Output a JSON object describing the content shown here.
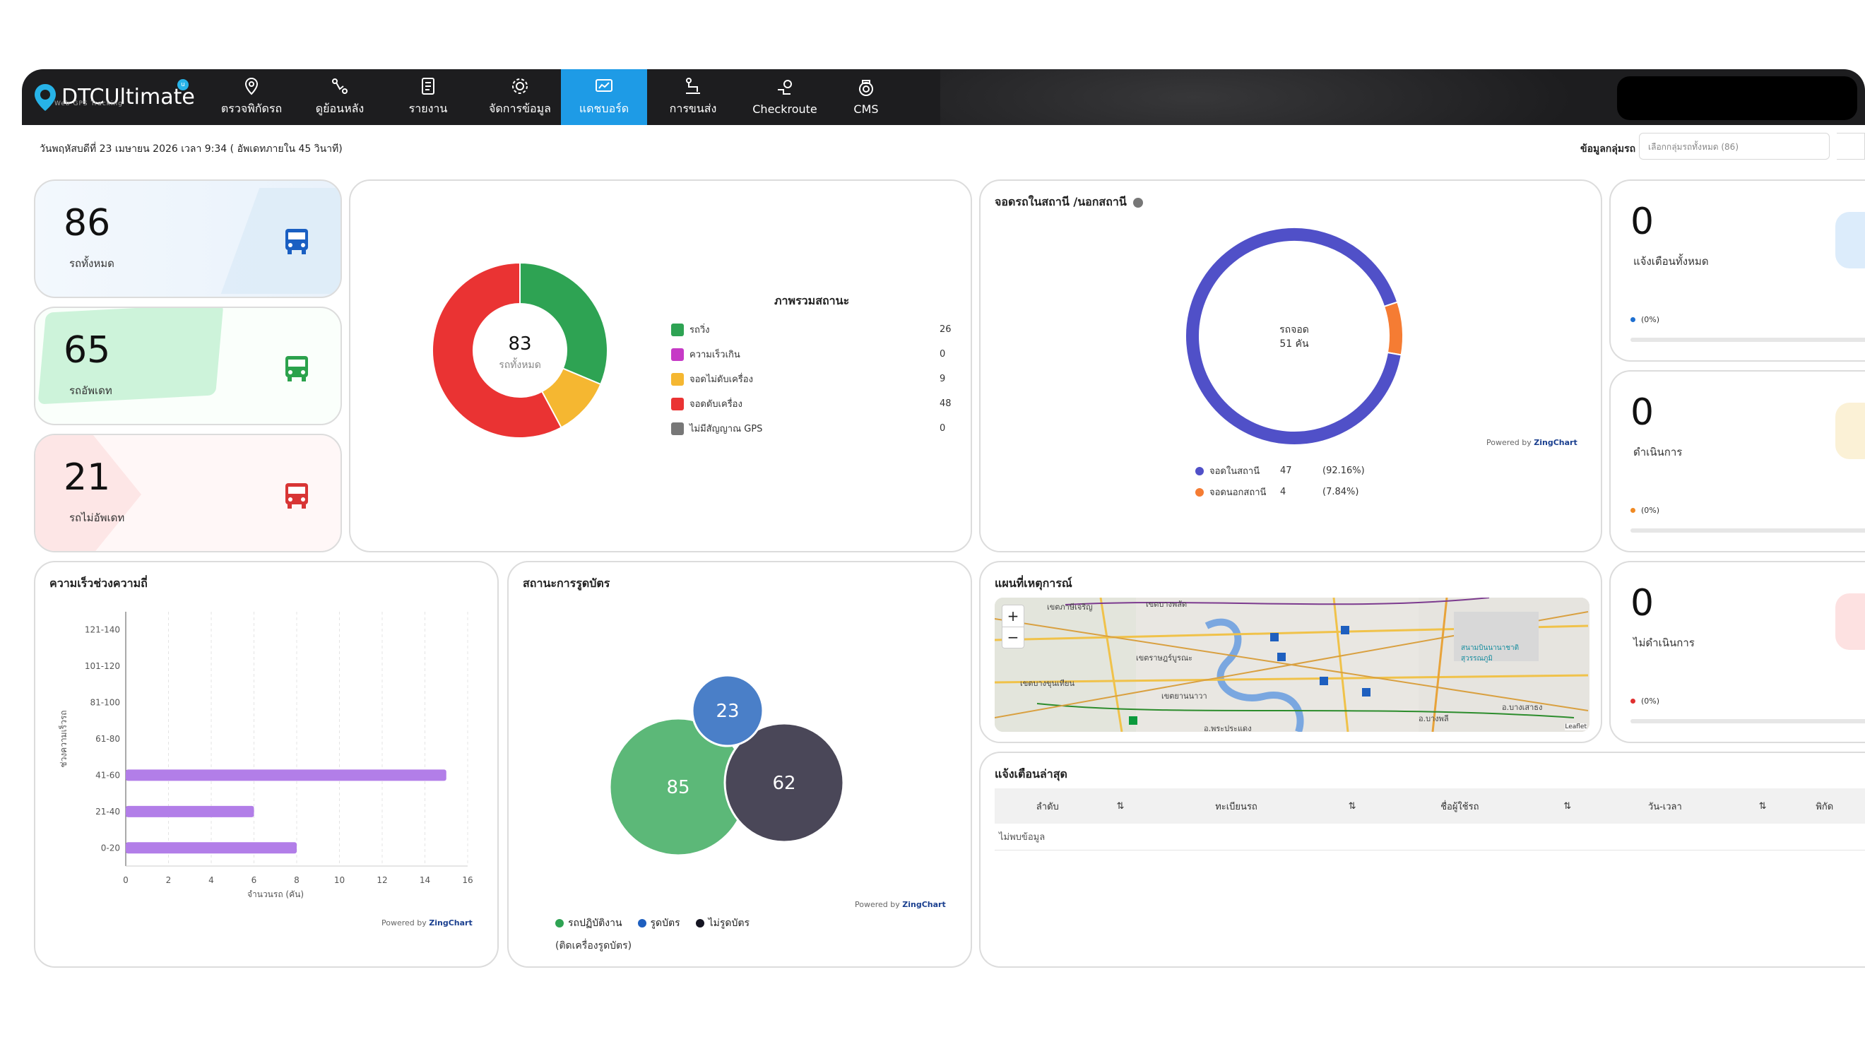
{
  "nav": {
    "brand": "DTCUltimate",
    "brand_sub": "Web GPS Tracking",
    "items": [
      {
        "label": "ตรวจพิกัดรถ",
        "icon": "map-pin-icon"
      },
      {
        "label": "ดูย้อนหลัง",
        "icon": "route-icon"
      },
      {
        "label": "รายงาน",
        "icon": "report-icon"
      },
      {
        "label": "จัดการข้อมูล",
        "icon": "manage-icon"
      },
      {
        "label": "แดชบอร์ด",
        "icon": "dashboard-icon",
        "active": true
      },
      {
        "label": "การขนส่ง",
        "icon": "transport-icon"
      },
      {
        "label": "Checkroute",
        "icon": "checkroute-icon"
      },
      {
        "label": "CMS",
        "icon": "cms-icon"
      }
    ]
  },
  "header": {
    "datetime": "วันพฤหัสบดีที่ 23 เมษายน 2026 เวลา 9:34 ( อัพเดทภายใน 45 วินาที)",
    "group_label": "ข้อมูลกลุ่มรถ",
    "group_placeholder": "เลือกกลุ่มรถทั้งหมด (86)"
  },
  "stats": [
    {
      "value": "86",
      "label": "รถทั้งหมด",
      "color": "#1a5fc2"
    },
    {
      "value": "65",
      "label": "รถอัพเดท",
      "color": "#2ba24c"
    },
    {
      "value": "21",
      "label": "รถไม่อัพเดท",
      "color": "#d83535"
    }
  ],
  "status_overview": {
    "title": "ภาพรวมสถานะ",
    "center_value": "83",
    "center_label": "รถทั้งหมด",
    "items": [
      {
        "label": "รถวิ่ง",
        "value": 26,
        "color": "#2ea353"
      },
      {
        "label": "ความเร็วเกิน",
        "value": 0,
        "color": "#c63ac6"
      },
      {
        "label": "จอดไม่ดับเครื่อง",
        "value": 9,
        "color": "#f5b731"
      },
      {
        "label": "จอดดับเครื่อง",
        "value": 48,
        "color": "#ea3333"
      },
      {
        "label": "ไม่มีสัญญาณ GPS",
        "value": 0,
        "color": "#777777"
      }
    ]
  },
  "station": {
    "title": "จอดรถในสถานี /นอกสถานี",
    "center_label": "รถจอด",
    "center_value": "51 คัน",
    "items": [
      {
        "label": "จอดในสถานี",
        "value": "47",
        "pct": "(92.16%)",
        "color": "#5050c8"
      },
      {
        "label": "จอดนอกสถานี",
        "value": "4",
        "pct": "(7.84%)",
        "color": "#f57c33"
      }
    ]
  },
  "powered": {
    "prefix": "Powered by",
    "brand": "ZingChart"
  },
  "notifications": [
    {
      "value": "0",
      "label": "แจ้งเตือนทั้งหมด",
      "pct": "(0%)",
      "dot": "#1e6fd0",
      "deco": "#dcecfb"
    },
    {
      "value": "0",
      "label": "ดำเนินการ",
      "pct": "(0%)",
      "dot": "#f08a24",
      "deco": "#fbf1d6"
    },
    {
      "value": "0",
      "label": "ไม่ดำเนินการ",
      "pct": "(0%)",
      "dot": "#e03030",
      "deco": "#fde1e1"
    }
  ],
  "speed": {
    "title": "ความเร็วช่วงความถี่",
    "ylabel": "ช่วงความเร็วรถ",
    "xlabel": "จำนวนรถ (คัน)"
  },
  "card_status": {
    "title": "สถานะการรูดบัตร",
    "legend": [
      "รถปฏิบัติงาน",
      "รูดบัตร",
      "ไม่รูดบัตร"
    ],
    "legend_note": "(ติดเครื่องรูดบัตร)",
    "bubbles": [
      {
        "label": "รถปฏิบัติงาน",
        "value": 85,
        "color": "#5cb878"
      },
      {
        "label": "รูดบัตร",
        "value": 23,
        "color": "#4a7fc8"
      },
      {
        "label": "ไม่รูดบัตร",
        "value": 62,
        "color": "#4a4758"
      }
    ]
  },
  "map": {
    "title": "แผนที่เหตุการณ์",
    "zoom_in": "+",
    "zoom_out": "−",
    "labels": [
      "เขตภาษีเจริญ",
      "เขตบางพลัด",
      "เขตราษฎร์บูรณะ",
      "เขตบางขุนเทียน",
      "เขตยานนาวา",
      "อ.พระประแดง",
      "อ.บางพลี",
      "อ.บางเสาธง",
      "สนามบินนานาชาติ สุวรรณภูมิ",
      "Leaflet"
    ]
  },
  "alerts": {
    "title": "แจ้งเตือนล่าสุด",
    "columns": [
      "ลำดับ",
      "ทะเบียนรถ",
      "ชื่อผู้ใช้รถ",
      "วัน-เวลา",
      "พิกัด"
    ],
    "sort_icon": "⇅",
    "empty": "ไม่พบข้อมูล"
  },
  "chart_data": [
    {
      "type": "pie",
      "title": "ภาพรวมสถานะ",
      "categories": [
        "รถวิ่ง",
        "ความเร็วเกิน",
        "จอดไม่ดับเครื่อง",
        "จอดดับเครื่อง",
        "ไม่มีสัญญาณ GPS"
      ],
      "values": [
        26,
        0,
        9,
        48,
        0
      ]
    },
    {
      "type": "pie",
      "title": "จอดรถในสถานี /นอกสถานี",
      "categories": [
        "จอดในสถานี",
        "จอดนอกสถานี"
      ],
      "values": [
        47,
        4
      ]
    },
    {
      "type": "bar",
      "title": "ความเร็วช่วงความถี่",
      "orientation": "horizontal",
      "categories": [
        "121-140",
        "101-120",
        "81-100",
        "61-80",
        "41-60",
        "21-40",
        "0-20"
      ],
      "values": [
        0,
        0,
        0,
        0,
        15,
        6,
        8
      ],
      "xlabel": "จำนวนรถ (คัน)",
      "ylabel": "ช่วงความเร็วรถ",
      "xlim": [
        0,
        16
      ],
      "xticks": [
        "0",
        "2",
        "4",
        "6",
        "8",
        "10",
        "12",
        "14",
        "16"
      ],
      "color": "#b27ee8"
    },
    {
      "type": "bubble",
      "title": "สถานะการรูดบัตร",
      "categories": [
        "รถปฏิบัติงาน",
        "รูดบัตร",
        "ไม่รูดบัตร"
      ],
      "values": [
        85,
        23,
        62
      ]
    }
  ]
}
